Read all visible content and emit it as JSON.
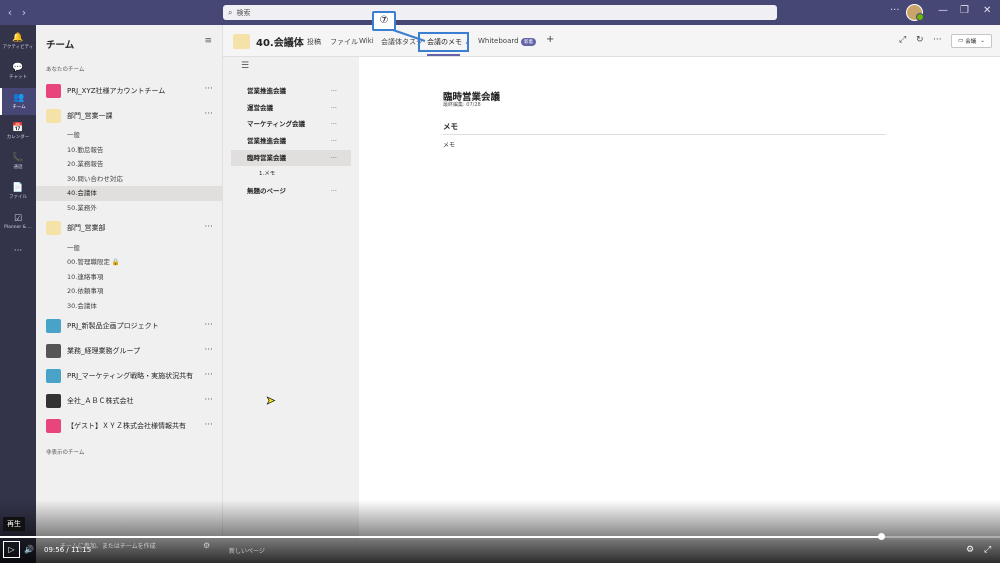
{
  "search": {
    "placeholder": "検索"
  },
  "rail": [
    {
      "icon": "🔔",
      "label": "アクティビティ"
    },
    {
      "icon": "💬",
      "label": "チャット"
    },
    {
      "icon": "👥",
      "label": "チーム"
    },
    {
      "icon": "📅",
      "label": "カレンダー"
    },
    {
      "icon": "📞",
      "label": "通話"
    },
    {
      "icon": "📄",
      "label": "ファイル"
    },
    {
      "icon": "☑",
      "label": "Planner & ..."
    },
    {
      "icon": "···",
      "label": ""
    }
  ],
  "teams_panel": {
    "title": "チーム",
    "section_label": "あなたのチーム",
    "hidden_label": "非表示のチーム",
    "teams": [
      {
        "name": "PRJ_XYZ社様アカウントチーム",
        "logo_color": "#e7457b",
        "channels": []
      },
      {
        "name": "部門_営業一課",
        "logo_color": "#f4e2a8",
        "channels": [
          "一般",
          "10.勤怠報告",
          "20.業務報告",
          "30.問い合わせ対応",
          "40.会議体",
          "50.業務外"
        ]
      },
      {
        "name": "部門_営業部",
        "logo_color": "#f4e2a8",
        "channels": [
          "一般",
          "00.管理職限定 🔒",
          "10.連絡事項",
          "20.依頼事項",
          "30.会議体"
        ]
      },
      {
        "name": "PRJ_新製品企画プロジェクト",
        "logo_color": "#49a3c8",
        "channels": []
      },
      {
        "name": "業務_経理業務グループ",
        "logo_color": "#555555",
        "channels": []
      },
      {
        "name": "PRJ_マーケティング戦略・実施状況共有",
        "logo_color": "#49a3c8",
        "channels": []
      },
      {
        "name": "全社_ＡＢＣ株式会社",
        "logo_color": "#333333",
        "channels": []
      },
      {
        "name": "【ゲスト】ＸＹＺ株式会社様情報共有",
        "logo_color": "#e7457b",
        "channels": []
      }
    ],
    "create_label": "チームに参加、またはチームを作成"
  },
  "channel_header": {
    "name": "40.会議体",
    "tabs": [
      "投稿",
      "ファイル",
      "Wiki",
      "会議体タスク",
      "会議のメモ ⌄",
      "Whiteboard"
    ],
    "whiteboard_badge": "新着",
    "add_tab": "+",
    "meeting_button": "会議"
  },
  "annotation": {
    "number": "⑦"
  },
  "pages": {
    "items": [
      {
        "label": "営業推進会議",
        "more": "···"
      },
      {
        "label": "運営会議",
        "more": "···"
      },
      {
        "label": "マーケティング会議",
        "more": "···"
      },
      {
        "label": "営業推進会議",
        "more": "···"
      },
      {
        "label": "臨時営業会議",
        "more": "···"
      }
    ],
    "subitem": "1.メモ",
    "untitled": {
      "label": "無題のページ",
      "more": "···"
    },
    "new_page": "新しいページ"
  },
  "document": {
    "title": "臨時営業会議",
    "last_edited": "最終編集: 07/28",
    "heading": "メモ",
    "body": "メモ"
  },
  "video": {
    "tooltip": "再生",
    "time": "09:56  /  11:15",
    "progress": 0.881
  }
}
